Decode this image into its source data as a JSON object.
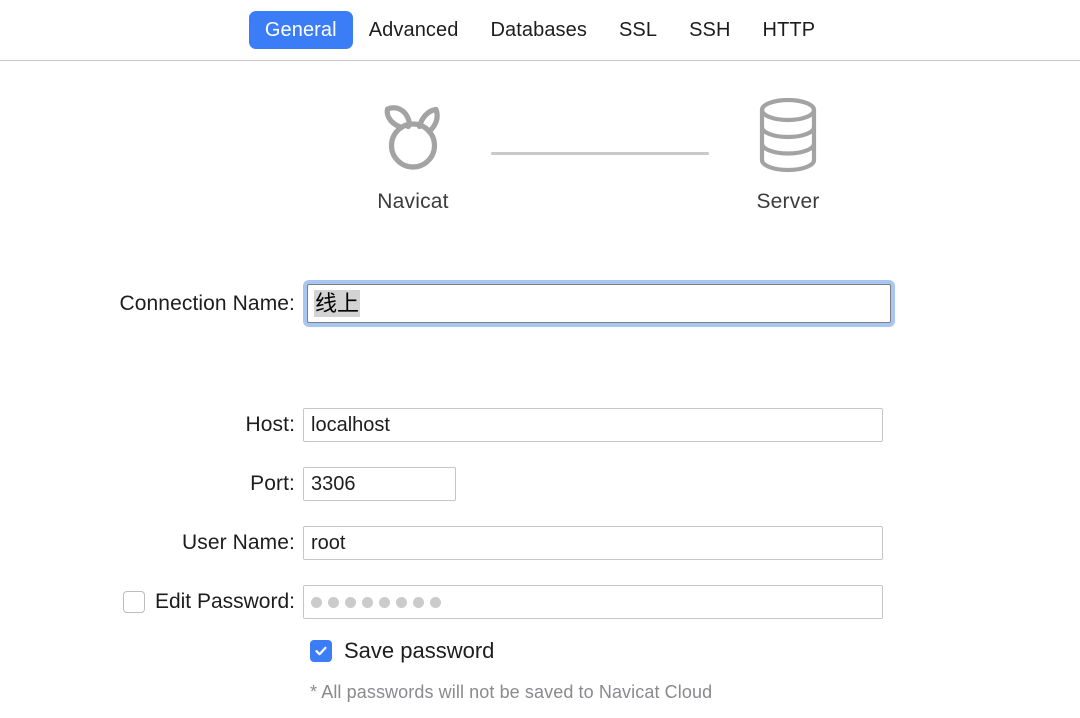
{
  "colors": {
    "accent": "#3b7df6",
    "focus_ring": "#a8c6f2",
    "icon_gray": "#9e9e9e",
    "divider": "#c9c9c9",
    "note_gray": "#8a8a8e",
    "selection_gray": "#d3d3d3"
  },
  "tabs": [
    {
      "label": "General",
      "active": true
    },
    {
      "label": "Advanced",
      "active": false
    },
    {
      "label": "Databases",
      "active": false
    },
    {
      "label": "SSL",
      "active": false
    },
    {
      "label": "SSH",
      "active": false
    },
    {
      "label": "HTTP",
      "active": false
    }
  ],
  "hero": {
    "client": {
      "label": "Navicat",
      "icon": "navicat-logo-icon"
    },
    "server": {
      "label": "Server",
      "icon": "database-cylinder-icon"
    },
    "connector": "connection-line"
  },
  "form": {
    "connection_name": {
      "label": "Connection Name:",
      "value": "线上",
      "placeholder": "",
      "focused": true,
      "selected": true
    },
    "host": {
      "label": "Host:",
      "value": "localhost",
      "placeholder": ""
    },
    "port": {
      "label": "Port:",
      "value": "3306",
      "placeholder": ""
    },
    "user_name": {
      "label": "User Name:",
      "value": "root",
      "placeholder": ""
    },
    "edit_password": {
      "label": "Edit Password:",
      "checked": false,
      "masked_value": "••••••••",
      "dot_count": 8
    },
    "save_password": {
      "label": "Save password",
      "checked": true
    },
    "note": "* All passwords will not be saved to Navicat Cloud"
  }
}
